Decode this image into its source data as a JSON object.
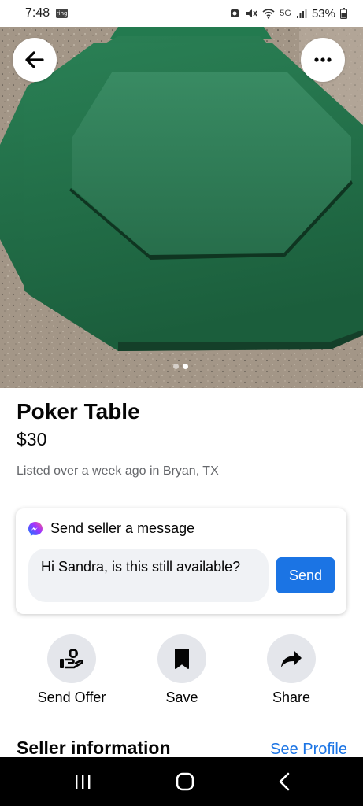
{
  "status_bar": {
    "time": "7:48",
    "notification_app": "ring",
    "network": "5G",
    "battery": "53%"
  },
  "listing": {
    "title": "Poker Table",
    "price": "$30",
    "listed": "Listed over a week ago in Bryan, TX",
    "photo_index": 2,
    "photo_count": 2
  },
  "message_card": {
    "heading": "Send seller a message",
    "message": "Hi Sandra, is this still available?",
    "send_label": "Send"
  },
  "actions": [
    {
      "label": "Send Offer",
      "icon": "offer-icon"
    },
    {
      "label": "Save",
      "icon": "bookmark-icon"
    },
    {
      "label": "Share",
      "icon": "share-icon"
    }
  ],
  "seller": {
    "heading": "Seller information",
    "see_profile": "See Profile"
  },
  "colors": {
    "accent": "#1b74e4",
    "table_green": "#1f6b45",
    "button_grey": "#e4e6eb"
  }
}
